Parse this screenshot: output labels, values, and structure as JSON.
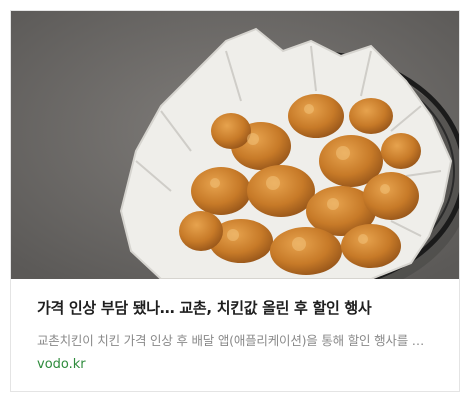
{
  "article": {
    "title": "가격 인상 부담 됐나… 교촌, 치킨값 올린 후 할인 행사",
    "description": "교촌치킨이 치킨 가격 인상 후 배달 앱(애플리케이션)을 통해 할인 행사를 …",
    "source": "vodo.kr",
    "thumbnail_icon": "fried-chicken-basket-photo"
  },
  "colors": {
    "title": "#1e1e1e",
    "description": "#8a8a8a",
    "source": "#2e8b3c",
    "border": "#e4e4e4"
  }
}
